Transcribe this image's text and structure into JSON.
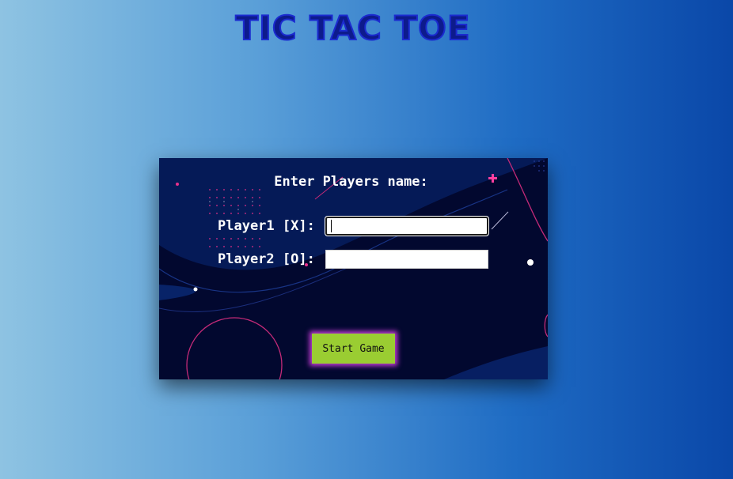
{
  "page": {
    "title": "TIC TAC TOE"
  },
  "form": {
    "heading": "Enter Players name:",
    "player1_label": "Player1 [X]:",
    "player1_value": "",
    "player2_label": "Player2 [O]:",
    "player2_value": "",
    "start_button_label": "Start Game"
  },
  "colors": {
    "background_gradient_start": "#8ec3e2",
    "background_gradient_end": "#0a47a8",
    "title_color": "#0d1b8c",
    "panel_bg": "#02082f",
    "accent_pink": "#e8318c",
    "button_bg": "#9acd32",
    "button_glow": "#c23bd4"
  }
}
